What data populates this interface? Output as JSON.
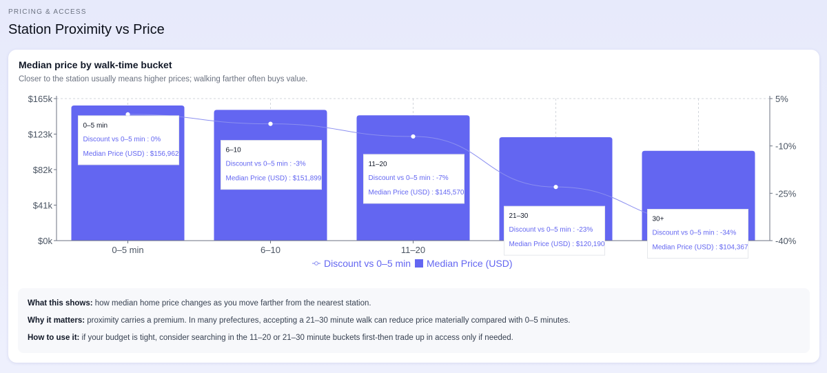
{
  "header": {
    "eyebrow": "PRICING & ACCESS",
    "title": "Station Proximity vs Price"
  },
  "card": {
    "title": "Median price by walk-time bucket",
    "subtitle": "Closer to the station usually means higher prices; walking farther often buys value."
  },
  "colors": {
    "bar": "#6366f1",
    "line": "#8b8ff0",
    "tooltip_text": "#6366f1"
  },
  "chart_data": {
    "type": "bar",
    "categories": [
      "0–5 min",
      "6–10",
      "11–20",
      "21–30",
      "30+"
    ],
    "series": [
      {
        "name": "Median Price (USD)",
        "type": "bar",
        "axis": "left",
        "values": [
          156962,
          151899,
          145570,
          120190,
          104367
        ],
        "formatted": [
          "$156,962",
          "$151,899",
          "$145,570",
          "$120,190",
          "$104,367"
        ]
      },
      {
        "name": "Discount vs 0–5 min",
        "type": "line",
        "axis": "right",
        "values": [
          0,
          -3,
          -7,
          -23,
          -34
        ],
        "formatted": [
          "0%",
          "-3%",
          "-7%",
          "-23%",
          "-34%"
        ]
      }
    ],
    "y_left": {
      "range": [
        0,
        165000
      ],
      "ticks": [
        "$0k",
        "$41k",
        "$82k",
        "$123k",
        "$165k"
      ],
      "tick_values": [
        0,
        41250,
        82500,
        123750,
        165000
      ]
    },
    "y_right": {
      "range": [
        -40,
        5
      ],
      "ticks": [
        "-40%",
        "-25%",
        "-10%",
        "5%"
      ],
      "tick_values": [
        -40,
        -25,
        -10,
        5
      ]
    },
    "grid": "vertical dashed",
    "legend": "bottom-center",
    "tooltips_visible": true
  },
  "info": {
    "lines": [
      {
        "label": "What this shows:",
        "text": "how median home price changes as you move farther from the nearest station."
      },
      {
        "label": "Why it matters:",
        "text": "proximity carries a premium. In many prefectures, accepting a 21–30 minute walk can reduce price materially compared with 0–5 minutes."
      },
      {
        "label": "How to use it:",
        "text": "if your budget is tight, consider searching in the 11–20 or 21–30 minute buckets first-then trade up in access only if needed."
      }
    ]
  }
}
